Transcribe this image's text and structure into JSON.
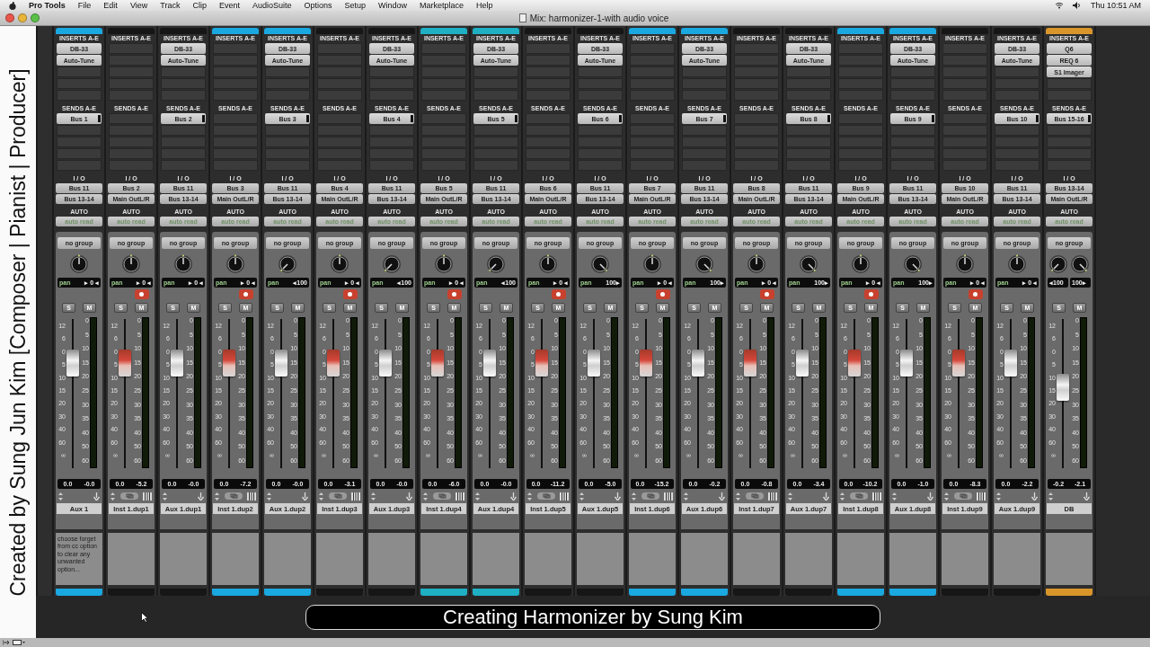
{
  "menu_bar": {
    "app": "Pro Tools",
    "items": [
      "File",
      "Edit",
      "View",
      "Track",
      "Clip",
      "Event",
      "AudioSuite",
      "Options",
      "Setup",
      "Window",
      "Marketplace",
      "Help"
    ],
    "clock": "Thu 10:51 AM"
  },
  "window": {
    "title": "Mix: harmonizer-1-with audio voice"
  },
  "credit": "Created by Sung Jun Kim [Composer | Pianist | Producer]",
  "strips": [
    {
      "name": "Aux 1",
      "kind": "aux",
      "color": "#1aa8e0",
      "inserts_label": "INSERTS A-E",
      "inserts": [
        "DB-33",
        "Auto-Tune"
      ],
      "sends_label": "SENDS A-E",
      "sends": [
        "Bus 1"
      ],
      "io_label": "I / O",
      "input": "Bus 11",
      "output": "Bus 13-14",
      "auto_label": "AUTO",
      "automation": "auto read",
      "group": "no group",
      "pans": [
        {
          "label": "pan",
          "value": "▸ 0 ◂",
          "kind": "center"
        }
      ],
      "solo": "S",
      "mute": "M",
      "fader_scale": [
        "12",
        "6",
        "0",
        "5",
        "10",
        "15",
        "20",
        "30",
        "40",
        "60",
        "∞"
      ],
      "meter_scale": [
        "0",
        "5",
        "10",
        "15",
        "20",
        "25",
        "30",
        "35",
        "40",
        "50",
        "60"
      ],
      "level": 0.75,
      "volume": "0.0",
      "peak": "-0.0",
      "comment": "choose forget from cc option to clear any unwanted option..."
    },
    {
      "name": "Inst 1.dup1",
      "kind": "inst",
      "inserts_label": "INSERTS A-E",
      "sends_label": "SENDS A-E",
      "io_label": "I / O",
      "input": "Bus 2",
      "output": "Main OutL/R",
      "auto_label": "AUTO",
      "automation": "auto read",
      "group": "no group",
      "pans": [
        {
          "label": "pan",
          "value": "▸ 0 ◂",
          "kind": "center"
        }
      ],
      "solo": "S",
      "mute": "M",
      "fader_scale": [
        "12",
        "6",
        "0",
        "5",
        "10",
        "15",
        "20",
        "30",
        "40",
        "60",
        "∞"
      ],
      "meter_scale": [
        "0",
        "5",
        "10",
        "15",
        "20",
        "25",
        "30",
        "35",
        "40",
        "50",
        "60"
      ],
      "level": 0.75,
      "volume": "0.0",
      "peak": "-5.2"
    },
    {
      "name": "Aux 1.dup1",
      "kind": "aux",
      "inserts_label": "INSERTS A-E",
      "inserts": [
        "DB-33",
        "Auto-Tune"
      ],
      "sends_label": "SENDS A-E",
      "sends": [
        "Bus 2"
      ],
      "io_label": "I / O",
      "input": "Bus 11",
      "output": "Bus 13-14",
      "auto_label": "AUTO",
      "automation": "auto read",
      "group": "no group",
      "pans": [
        {
          "label": "pan",
          "value": "▸ 0 ◂",
          "kind": "center"
        }
      ],
      "solo": "S",
      "mute": "M",
      "fader_scale": [
        "12",
        "6",
        "0",
        "5",
        "10",
        "15",
        "20",
        "30",
        "40",
        "60",
        "∞"
      ],
      "meter_scale": [
        "0",
        "5",
        "10",
        "15",
        "20",
        "25",
        "30",
        "35",
        "40",
        "50",
        "60"
      ],
      "level": 0.75,
      "volume": "0.0",
      "peak": "-0.0"
    },
    {
      "name": "Inst 1.dup2",
      "kind": "inst",
      "color": "#1aa8e0",
      "inserts_label": "INSERTS A-E",
      "sends_label": "SENDS A-E",
      "io_label": "I / O",
      "input": "Bus 3",
      "output": "Main OutL/R",
      "auto_label": "AUTO",
      "automation": "auto read",
      "group": "no group",
      "pans": [
        {
          "label": "pan",
          "value": "▸ 0 ◂",
          "kind": "center"
        }
      ],
      "solo": "S",
      "mute": "M",
      "fader_scale": [
        "12",
        "6",
        "0",
        "5",
        "10",
        "15",
        "20",
        "30",
        "40",
        "60",
        "∞"
      ],
      "meter_scale": [
        "0",
        "5",
        "10",
        "15",
        "20",
        "25",
        "30",
        "35",
        "40",
        "50",
        "60"
      ],
      "level": 0.75,
      "volume": "0.0",
      "peak": "-7.2"
    },
    {
      "name": "Aux 1.dup2",
      "kind": "aux",
      "color": "#1aa8e0",
      "inserts_label": "INSERTS A-E",
      "inserts": [
        "DB-33",
        "Auto-Tune"
      ],
      "sends_label": "SENDS A-E",
      "sends": [
        "Bus 3"
      ],
      "io_label": "I / O",
      "input": "Bus 11",
      "output": "Bus 13-14",
      "auto_label": "AUTO",
      "automation": "auto read",
      "group": "no group",
      "pans": [
        {
          "label": "pan",
          "value": "◂100",
          "kind": "left"
        }
      ],
      "solo": "S",
      "mute": "M",
      "fader_scale": [
        "12",
        "6",
        "0",
        "5",
        "10",
        "15",
        "20",
        "30",
        "40",
        "60",
        "∞"
      ],
      "meter_scale": [
        "0",
        "5",
        "10",
        "15",
        "20",
        "25",
        "30",
        "35",
        "40",
        "50",
        "60"
      ],
      "level": 0.75,
      "volume": "0.0",
      "peak": "-0.0"
    },
    {
      "name": "Inst 1.dup3",
      "kind": "inst",
      "inserts_label": "INSERTS A-E",
      "sends_label": "SENDS A-E",
      "io_label": "I / O",
      "input": "Bus 4",
      "output": "Main OutL/R",
      "auto_label": "AUTO",
      "automation": "auto read",
      "group": "no group",
      "pans": [
        {
          "label": "pan",
          "value": "▸ 0 ◂",
          "kind": "center"
        }
      ],
      "solo": "S",
      "mute": "M",
      "fader_scale": [
        "12",
        "6",
        "0",
        "5",
        "10",
        "15",
        "20",
        "30",
        "40",
        "60",
        "∞"
      ],
      "meter_scale": [
        "0",
        "5",
        "10",
        "15",
        "20",
        "25",
        "30",
        "35",
        "40",
        "50",
        "60"
      ],
      "level": 0.75,
      "volume": "0.0",
      "peak": "-3.1"
    },
    {
      "name": "Aux 1.dup3",
      "kind": "aux",
      "inserts_label": "INSERTS A-E",
      "inserts": [
        "DB-33",
        "Auto-Tune"
      ],
      "sends_label": "SENDS A-E",
      "sends": [
        "Bus 4"
      ],
      "io_label": "I / O",
      "input": "Bus 11",
      "output": "Bus 13-14",
      "auto_label": "AUTO",
      "automation": "auto read",
      "group": "no group",
      "pans": [
        {
          "label": "pan",
          "value": "◂100",
          "kind": "left"
        }
      ],
      "solo": "S",
      "mute": "M",
      "fader_scale": [
        "12",
        "6",
        "0",
        "5",
        "10",
        "15",
        "20",
        "30",
        "40",
        "60",
        "∞"
      ],
      "meter_scale": [
        "0",
        "5",
        "10",
        "15",
        "20",
        "25",
        "30",
        "35",
        "40",
        "50",
        "60"
      ],
      "level": 0.75,
      "volume": "0.0",
      "peak": "-0.0"
    },
    {
      "name": "Inst 1.dup4",
      "kind": "inst",
      "color": "#1fb0c4",
      "inserts_label": "INSERTS A-E",
      "sends_label": "SENDS A-E",
      "io_label": "I / O",
      "input": "Bus 5",
      "output": "Main OutL/R",
      "auto_label": "AUTO",
      "automation": "auto read",
      "group": "no group",
      "pans": [
        {
          "label": "pan",
          "value": "▸ 0 ◂",
          "kind": "center"
        }
      ],
      "solo": "S",
      "mute": "M",
      "fader_scale": [
        "12",
        "6",
        "0",
        "5",
        "10",
        "15",
        "20",
        "30",
        "40",
        "60",
        "∞"
      ],
      "meter_scale": [
        "0",
        "5",
        "10",
        "15",
        "20",
        "25",
        "30",
        "35",
        "40",
        "50",
        "60"
      ],
      "level": 0.75,
      "volume": "0.0",
      "peak": "-6.0"
    },
    {
      "name": "Aux 1.dup4",
      "kind": "aux",
      "color": "#1fb0c4",
      "inserts_label": "INSERTS A-E",
      "inserts": [
        "DB-33",
        "Auto-Tune"
      ],
      "sends_label": "SENDS A-E",
      "sends": [
        "Bus 5"
      ],
      "io_label": "I / O",
      "input": "Bus 11",
      "output": "Bus 13-14",
      "auto_label": "AUTO",
      "automation": "auto read",
      "group": "no group",
      "pans": [
        {
          "label": "pan",
          "value": "◂100",
          "kind": "left"
        }
      ],
      "solo": "S",
      "mute": "M",
      "fader_scale": [
        "12",
        "6",
        "0",
        "5",
        "10",
        "15",
        "20",
        "30",
        "40",
        "60",
        "∞"
      ],
      "meter_scale": [
        "0",
        "5",
        "10",
        "15",
        "20",
        "25",
        "30",
        "35",
        "40",
        "50",
        "60"
      ],
      "level": 0.75,
      "volume": "0.0",
      "peak": "-0.0"
    },
    {
      "name": "Inst 1.dup5",
      "kind": "inst",
      "inserts_label": "INSERTS A-E",
      "sends_label": "SENDS A-E",
      "io_label": "I / O",
      "input": "Bus 6",
      "output": "Main OutL/R",
      "auto_label": "AUTO",
      "automation": "auto read",
      "group": "no group",
      "pans": [
        {
          "label": "pan",
          "value": "▸ 0 ◂",
          "kind": "center"
        }
      ],
      "solo": "S",
      "mute": "M",
      "fader_scale": [
        "12",
        "6",
        "0",
        "5",
        "10",
        "15",
        "20",
        "30",
        "40",
        "60",
        "∞"
      ],
      "meter_scale": [
        "0",
        "5",
        "10",
        "15",
        "20",
        "25",
        "30",
        "35",
        "40",
        "50",
        "60"
      ],
      "level": 0.75,
      "volume": "0.0",
      "peak": "-11.2"
    },
    {
      "name": "Aux 1.dup5",
      "kind": "aux",
      "inserts_label": "INSERTS A-E",
      "inserts": [
        "DB-33",
        "Auto-Tune"
      ],
      "sends_label": "SENDS A-E",
      "sends": [
        "Bus 6"
      ],
      "io_label": "I / O",
      "input": "Bus 11",
      "output": "Bus 13-14",
      "auto_label": "AUTO",
      "automation": "auto read",
      "group": "no group",
      "pans": [
        {
          "label": "pan",
          "value": "100▸",
          "kind": "right"
        }
      ],
      "solo": "S",
      "mute": "M",
      "fader_scale": [
        "12",
        "6",
        "0",
        "5",
        "10",
        "15",
        "20",
        "30",
        "40",
        "60",
        "∞"
      ],
      "meter_scale": [
        "0",
        "5",
        "10",
        "15",
        "20",
        "25",
        "30",
        "35",
        "40",
        "50",
        "60"
      ],
      "level": 0.75,
      "volume": "0.0",
      "peak": "-5.0"
    },
    {
      "name": "Inst 1.dup6",
      "kind": "inst",
      "color": "#1aa8e0",
      "inserts_label": "INSERTS A-E",
      "sends_label": "SENDS A-E",
      "io_label": "I / O",
      "input": "Bus 7",
      "output": "Main OutL/R",
      "auto_label": "AUTO",
      "automation": "auto read",
      "group": "no group",
      "pans": [
        {
          "label": "pan",
          "value": "▸ 0 ◂",
          "kind": "center"
        }
      ],
      "solo": "S",
      "mute": "M",
      "fader_scale": [
        "12",
        "6",
        "0",
        "5",
        "10",
        "15",
        "20",
        "30",
        "40",
        "60",
        "∞"
      ],
      "meter_scale": [
        "0",
        "5",
        "10",
        "15",
        "20",
        "25",
        "30",
        "35",
        "40",
        "50",
        "60"
      ],
      "level": 0.75,
      "volume": "0.0",
      "peak": "-15.2"
    },
    {
      "name": "Aux 1.dup6",
      "kind": "aux",
      "color": "#1aa8e0",
      "inserts_label": "INSERTS A-E",
      "inserts": [
        "DB-33",
        "Auto-Tune"
      ],
      "sends_label": "SENDS A-E",
      "sends": [
        "Bus 7"
      ],
      "io_label": "I / O",
      "input": "Bus 11",
      "output": "Bus 13-14",
      "auto_label": "AUTO",
      "automation": "auto read",
      "group": "no group",
      "pans": [
        {
          "label": "pan",
          "value": "100▸",
          "kind": "right"
        }
      ],
      "solo": "S",
      "mute": "M",
      "fader_scale": [
        "12",
        "6",
        "0",
        "5",
        "10",
        "15",
        "20",
        "30",
        "40",
        "60",
        "∞"
      ],
      "meter_scale": [
        "0",
        "5",
        "10",
        "15",
        "20",
        "25",
        "30",
        "35",
        "40",
        "50",
        "60"
      ],
      "level": 0.75,
      "volume": "0.0",
      "peak": "-0.2"
    },
    {
      "name": "Inst 1.dup7",
      "kind": "inst",
      "inserts_label": "INSERTS A-E",
      "sends_label": "SENDS A-E",
      "io_label": "I / O",
      "input": "Bus 8",
      "output": "Main OutL/R",
      "auto_label": "AUTO",
      "automation": "auto read",
      "group": "no group",
      "pans": [
        {
          "label": "pan",
          "value": "▸ 0 ◂",
          "kind": "center"
        }
      ],
      "solo": "S",
      "mute": "M",
      "fader_scale": [
        "12",
        "6",
        "0",
        "5",
        "10",
        "15",
        "20",
        "30",
        "40",
        "60",
        "∞"
      ],
      "meter_scale": [
        "0",
        "5",
        "10",
        "15",
        "20",
        "25",
        "30",
        "35",
        "40",
        "50",
        "60"
      ],
      "level": 0.75,
      "volume": "0.0",
      "peak": "-0.8"
    },
    {
      "name": "Aux 1.dup7",
      "kind": "aux",
      "inserts_label": "INSERTS A-E",
      "inserts": [
        "DB-33",
        "Auto-Tune"
      ],
      "sends_label": "SENDS A-E",
      "sends": [
        "Bus 8"
      ],
      "io_label": "I / O",
      "input": "Bus 11",
      "output": "Bus 13-14",
      "auto_label": "AUTO",
      "automation": "auto read",
      "group": "no group",
      "pans": [
        {
          "label": "pan",
          "value": "100▸",
          "kind": "right"
        }
      ],
      "solo": "S",
      "mute": "M",
      "fader_scale": [
        "12",
        "6",
        "0",
        "5",
        "10",
        "15",
        "20",
        "30",
        "40",
        "60",
        "∞"
      ],
      "meter_scale": [
        "0",
        "5",
        "10",
        "15",
        "20",
        "25",
        "30",
        "35",
        "40",
        "50",
        "60"
      ],
      "level": 0.75,
      "volume": "0.0",
      "peak": "-3.4"
    },
    {
      "name": "Inst 1.dup8",
      "kind": "inst",
      "color": "#1aa8e0",
      "inserts_label": "INSERTS A-E",
      "sends_label": "SENDS A-E",
      "io_label": "I / O",
      "input": "Bus 9",
      "output": "Main OutL/R",
      "auto_label": "AUTO",
      "automation": "auto read",
      "group": "no group",
      "pans": [
        {
          "label": "pan",
          "value": "▸ 0 ◂",
          "kind": "center"
        }
      ],
      "solo": "S",
      "mute": "M",
      "fader_scale": [
        "12",
        "6",
        "0",
        "5",
        "10",
        "15",
        "20",
        "30",
        "40",
        "60",
        "∞"
      ],
      "meter_scale": [
        "0",
        "5",
        "10",
        "15",
        "20",
        "25",
        "30",
        "35",
        "40",
        "50",
        "60"
      ],
      "level": 0.75,
      "volume": "0.0",
      "peak": "-10.2"
    },
    {
      "name": "Aux 1.dup8",
      "kind": "aux",
      "color": "#1aa8e0",
      "inserts_label": "INSERTS A-E",
      "inserts": [
        "DB-33",
        "Auto-Tune"
      ],
      "sends_label": "SENDS A-E",
      "sends": [
        "Bus 9"
      ],
      "io_label": "I / O",
      "input": "Bus 11",
      "output": "Bus 13-14",
      "auto_label": "AUTO",
      "automation": "auto read",
      "group": "no group",
      "pans": [
        {
          "label": "pan",
          "value": "100▸",
          "kind": "right"
        }
      ],
      "solo": "S",
      "mute": "M",
      "fader_scale": [
        "12",
        "6",
        "0",
        "5",
        "10",
        "15",
        "20",
        "30",
        "40",
        "60",
        "∞"
      ],
      "meter_scale": [
        "0",
        "5",
        "10",
        "15",
        "20",
        "25",
        "30",
        "35",
        "40",
        "50",
        "60"
      ],
      "level": 0.75,
      "volume": "0.0",
      "peak": "-1.0"
    },
    {
      "name": "Inst 1.dup9",
      "kind": "inst",
      "inserts_label": "INSERTS A-E",
      "sends_label": "SENDS A-E",
      "io_label": "I / O",
      "input": "Bus 10",
      "output": "Main OutL/R",
      "auto_label": "AUTO",
      "automation": "auto read",
      "group": "no group",
      "pans": [
        {
          "label": "pan",
          "value": "▸ 0 ◂",
          "kind": "center"
        }
      ],
      "solo": "S",
      "mute": "M",
      "fader_scale": [
        "12",
        "6",
        "0",
        "5",
        "10",
        "15",
        "20",
        "30",
        "40",
        "60",
        "∞"
      ],
      "meter_scale": [
        "0",
        "5",
        "10",
        "15",
        "20",
        "25",
        "30",
        "35",
        "40",
        "50",
        "60"
      ],
      "level": 0.75,
      "volume": "0.0",
      "peak": "-8.3"
    },
    {
      "name": "Aux 1.dup9",
      "kind": "aux",
      "inserts_label": "INSERTS A-E",
      "inserts": [
        "DB-33",
        "Auto-Tune"
      ],
      "sends_label": "SENDS A-E",
      "sends": [
        "Bus 10"
      ],
      "io_label": "I / O",
      "input": "Bus 11",
      "output": "Bus 13-14",
      "auto_label": "AUTO",
      "automation": "auto read",
      "group": "no group",
      "pans": [
        {
          "label": "pan",
          "value": "▸ 0 ◂",
          "kind": "center"
        }
      ],
      "solo": "S",
      "mute": "M",
      "fader_scale": [
        "12",
        "6",
        "0",
        "5",
        "10",
        "15",
        "20",
        "30",
        "40",
        "60",
        "∞"
      ],
      "meter_scale": [
        "0",
        "5",
        "10",
        "15",
        "20",
        "25",
        "30",
        "35",
        "40",
        "50",
        "60"
      ],
      "level": 0.75,
      "volume": "0.0",
      "peak": "-2.2"
    },
    {
      "name": "DB",
      "kind": "aux",
      "color": "#d8962a",
      "inserts_label": "INSERTS A-E",
      "inserts": [
        "Q6",
        "REQ 6",
        "S1 Imager"
      ],
      "sends_label": "SENDS A-E",
      "sends": [
        "Bus 15-16"
      ],
      "io_label": "I / O",
      "input": "Bus 13-14",
      "output": "Main OutL/R",
      "auto_label": "AUTO",
      "automation": "auto read",
      "group": "no group",
      "pans": [
        {
          "value": "◂100",
          "kind": "left"
        },
        {
          "value": "100▸",
          "kind": "right"
        }
      ],
      "solo": "S",
      "mute": "M",
      "fader_scale": [
        "12",
        "6",
        "0",
        "5",
        "10",
        "15",
        "20",
        "30",
        "40",
        "60",
        "∞"
      ],
      "meter_scale": [
        "0",
        "5",
        "10",
        "15",
        "20",
        "25",
        "30",
        "35",
        "40",
        "50",
        "60"
      ],
      "level": 0.55,
      "volume": "-0.2",
      "peak": "-2.1"
    }
  ],
  "caption": "Creating Harmonizer by Sung Kim"
}
